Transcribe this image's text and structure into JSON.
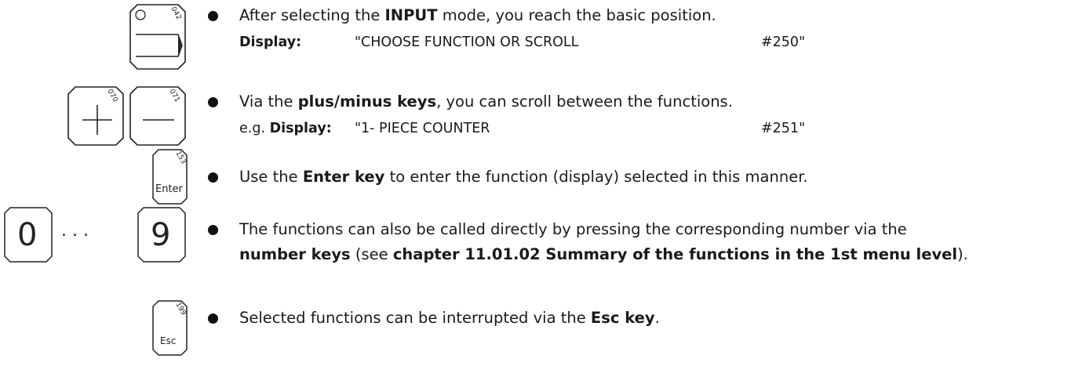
{
  "keys": {
    "input": {
      "code": "042"
    },
    "plus": {
      "code": "070"
    },
    "minus": {
      "code": "071"
    },
    "enter": {
      "code": "153",
      "label": "Enter"
    },
    "digit_first": "0",
    "digit_sep": "...",
    "digit_last": "9",
    "esc": {
      "code": "199",
      "label": "Esc"
    }
  },
  "items": [
    {
      "pre": "After selecting the ",
      "bold": "INPUT",
      "post": " mode, you reach the basic position.",
      "display_prefix": "",
      "display_label": "Display:",
      "display_text": "\"CHOOSE FUNCTION OR SCROLL",
      "display_code": "#250\""
    },
    {
      "pre": "Via the ",
      "bold": "plus/minus keys",
      "post": ", you can scroll between the functions.",
      "display_prefix": "e.g. ",
      "display_label": "Display:",
      "display_text": "\"1- PIECE COUNTER",
      "display_code": "#251\""
    },
    {
      "pre": "Use the ",
      "bold": "Enter key",
      "post": " to enter the function (display) selected in this manner."
    },
    {
      "line1": "The functions can also be called directly by pressing the corresponding number via the",
      "bold_a": "number keys",
      "mid": " (see ",
      "bold_b": "chapter 11.01.02 Summary of the functions in the 1st menu level",
      "end": ")."
    },
    {
      "pre": "Selected functions can be interrupted via the ",
      "bold": "Esc key",
      "post": "."
    }
  ]
}
